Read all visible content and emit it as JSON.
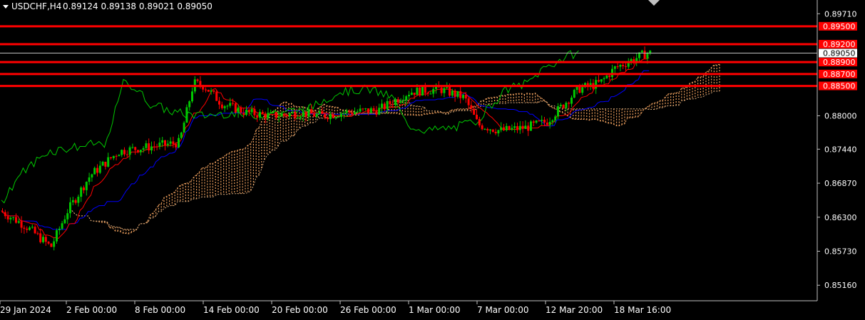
{
  "header": {
    "symbol_timeframe": "USDCHF,H4",
    "quote": "0.89124 0.89138 0.89021 0.89050"
  },
  "colors": {
    "background": "#000000",
    "grid_frame": "#c0c0c0",
    "bull_candle": "#00c800",
    "bear_candle": "#ff0000",
    "tenkan": "#ff0000",
    "kijun": "#0000ff",
    "chikou": "#00c800",
    "cloud": "#f4a460",
    "level_line": "#ff0000",
    "price_box": "#ffffff"
  },
  "chart_data": {
    "type": "candlestick",
    "indicator": "Ichimoku Kinko Hyo",
    "y_range": [
      0.849,
      0.8994
    ],
    "y_ticks": [
      "0.89710",
      "0.88000",
      "0.87440",
      "0.86870",
      "0.86300",
      "0.85730",
      "0.85160"
    ],
    "x_ticks": [
      "29 Jan 2024",
      "2 Feb 00:00",
      "8 Feb 00:00",
      "14 Feb 00:00",
      "20 Feb 00:00",
      "26 Feb 00:00",
      "1 Mar 00:00",
      "7 Mar 00:00",
      "12 Mar 20:00",
      "18 Mar 16:00"
    ],
    "horizontal_levels": [
      "0.89500",
      "0.89200",
      "0.88900",
      "0.88700",
      "0.88500"
    ],
    "current_price": "0.89050",
    "price_anchors": [
      {
        "date": "29 Jan 2024",
        "price": 0.864
      },
      {
        "date": "31 Jan 2024",
        "price": 0.8615
      },
      {
        "date": "1 Feb 2024",
        "price": 0.858
      },
      {
        "date": "2 Feb 00:00",
        "price": 0.864
      },
      {
        "date": "5 Feb 2024",
        "price": 0.87
      },
      {
        "date": "7 Feb 2024",
        "price": 0.874
      },
      {
        "date": "8 Feb 00:00",
        "price": 0.8745
      },
      {
        "date": "12 Feb 2024",
        "price": 0.8755
      },
      {
        "date": "13 Feb 2024",
        "price": 0.8855
      },
      {
        "date": "14 Feb 00:00",
        "price": 0.885
      },
      {
        "date": "15 Feb 2024",
        "price": 0.882
      },
      {
        "date": "16 Feb 2024",
        "price": 0.8805
      },
      {
        "date": "20 Feb 00:00",
        "price": 0.88
      },
      {
        "date": "21 Feb 2024",
        "price": 0.8805
      },
      {
        "date": "22 Feb 2024",
        "price": 0.88
      },
      {
        "date": "26 Feb 00:00",
        "price": 0.8805
      },
      {
        "date": "28 Feb 2024",
        "price": 0.881
      },
      {
        "date": "1 Mar 00:00",
        "price": 0.884
      },
      {
        "date": "4 Mar 2024",
        "price": 0.8845
      },
      {
        "date": "6 Mar 2024",
        "price": 0.883
      },
      {
        "date": "7 Mar 00:00",
        "price": 0.8785
      },
      {
        "date": "8 Mar 2024",
        "price": 0.8775
      },
      {
        "date": "11 Mar 2024",
        "price": 0.878
      },
      {
        "date": "12 Mar 20:00",
        "price": 0.879
      },
      {
        "date": "14 Mar 2024",
        "price": 0.8845
      },
      {
        "date": "15 Mar 2024",
        "price": 0.8855
      },
      {
        "date": "18 Mar 16:00",
        "price": 0.888
      },
      {
        "date": "19 Mar 2024",
        "price": 0.8905
      }
    ],
    "grid": false,
    "legend": "none"
  }
}
